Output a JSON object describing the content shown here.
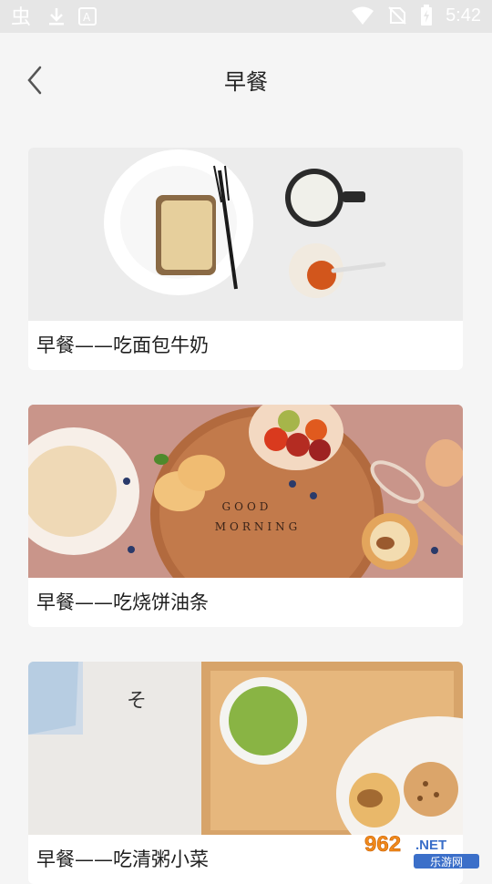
{
  "status_bar": {
    "time": "5:42",
    "icons": [
      "bug-icon",
      "download-icon",
      "app-icon",
      "wifi-icon",
      "no-sim-icon",
      "battery-charging-icon"
    ]
  },
  "header": {
    "title": "早餐",
    "back_icon": "chevron-left-icon"
  },
  "cards": [
    {
      "label": "早餐——吃面包牛奶",
      "image": "bread-and-milk-photo"
    },
    {
      "label": "早餐——吃烧饼油条",
      "image": "good-morning-board-photo",
      "image_text": [
        "GOOD",
        "MORNING"
      ]
    },
    {
      "label": "早餐——吃清粥小菜",
      "image": "congee-tray-photo",
      "image_text": "そ"
    }
  ],
  "watermark": {
    "text_top": "962",
    "text_suffix": ".NET",
    "text_bottom": "乐游网"
  },
  "colors": {
    "background": "#f5f5f5",
    "card": "#ffffff",
    "text": "#1f1f1f"
  }
}
